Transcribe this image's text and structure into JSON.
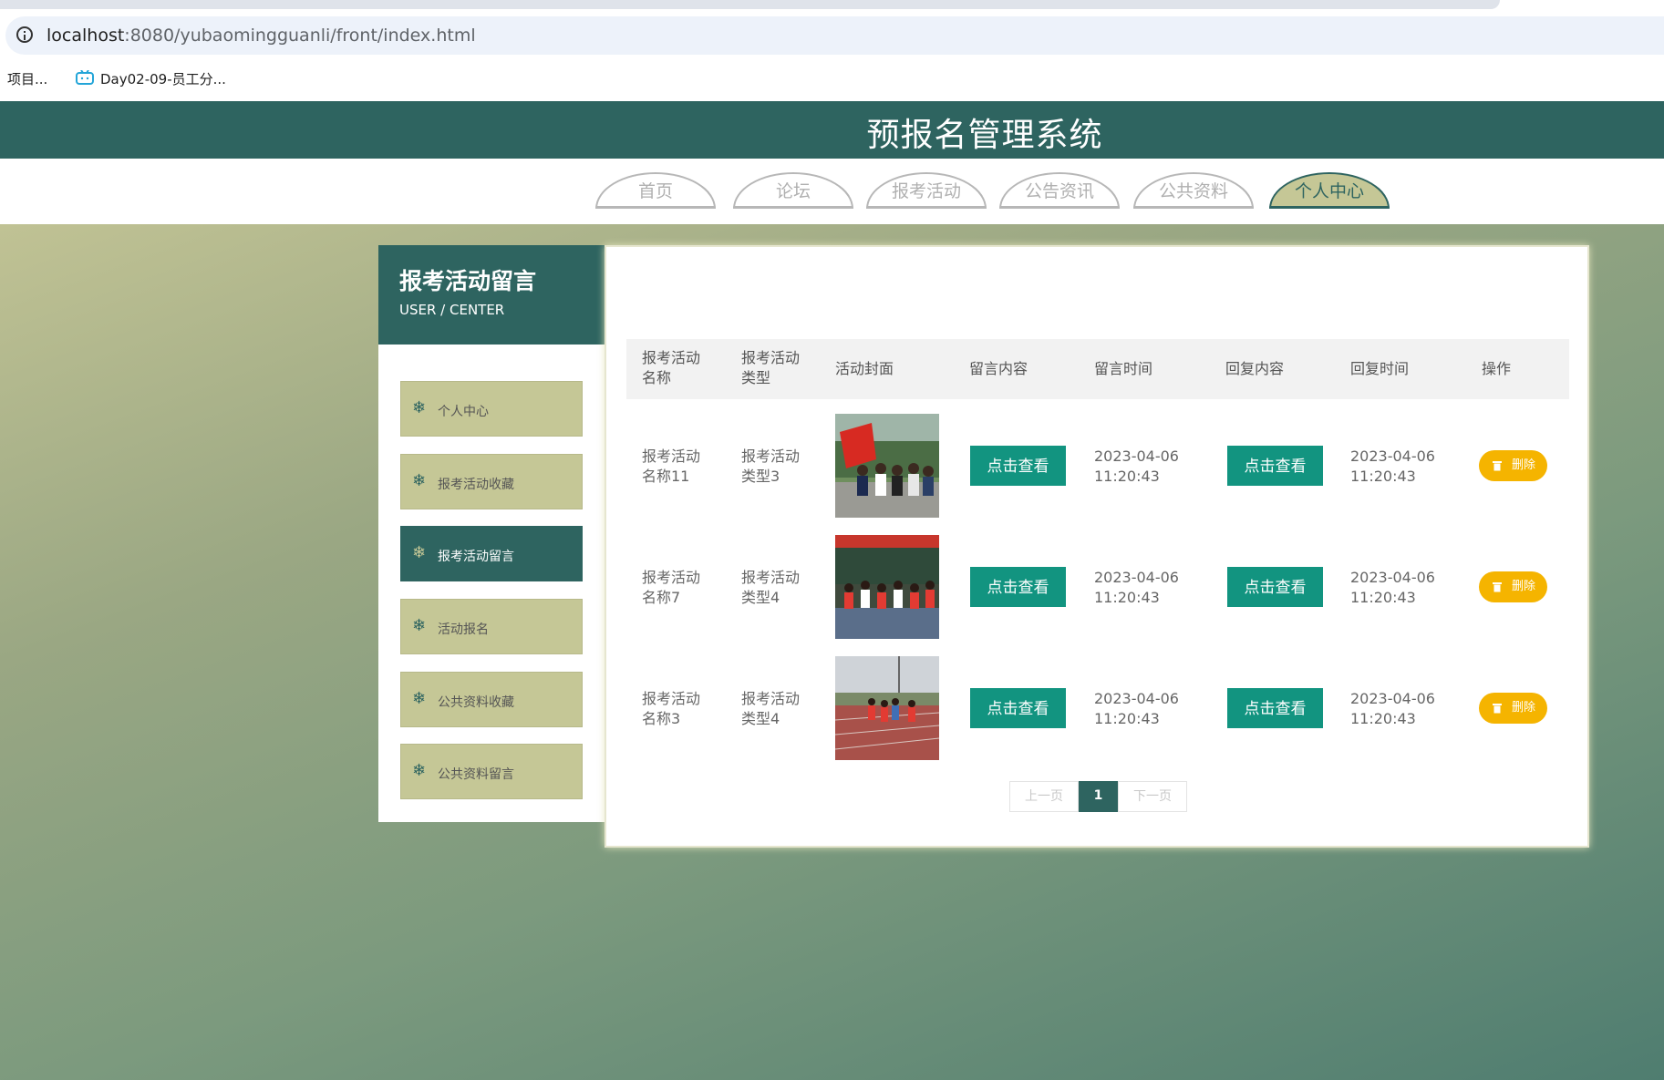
{
  "browser": {
    "url_host": "localhost",
    "url_rest": ":8080/yubaomingguanli/front/index.html",
    "bookmarks": [
      {
        "label": "项目..."
      },
      {
        "label": "Day02-09-员工分..."
      }
    ]
  },
  "site": {
    "title": "预报名管理系统",
    "nav": [
      {
        "label": "首页"
      },
      {
        "label": "论坛"
      },
      {
        "label": "报考活动"
      },
      {
        "label": "公告资讯"
      },
      {
        "label": "公共资料"
      },
      {
        "label": "个人中心",
        "active": true
      }
    ]
  },
  "sidebar": {
    "title": "报考活动留言",
    "subtitle": "USER / CENTER",
    "icon": "snowflake-icon",
    "items": [
      {
        "label": "个人中心"
      },
      {
        "label": "报考活动收藏"
      },
      {
        "label": "报考活动留言",
        "active": true
      },
      {
        "label": "活动报名"
      },
      {
        "label": "公共资料收藏"
      },
      {
        "label": "公共资料留言"
      }
    ]
  },
  "table": {
    "headers": {
      "name": "报考活动\n名称",
      "type": "报考活动\n类型",
      "cover": "活动封面",
      "content": "留言内容",
      "time": "留言时间",
      "reply": "回复内容",
      "reply_time": "回复时间",
      "ops": "操作"
    },
    "view_label": "点击查看",
    "delete_label": "删除",
    "rows": [
      {
        "name": "报考活动\n名称11",
        "type": "报考活动\n类型3",
        "time": "2023-04-06\n11:20:43",
        "reply_time": "2023-04-06\n11:20:43"
      },
      {
        "name": "报考活动\n名称7",
        "type": "报考活动\n类型4",
        "time": "2023-04-06\n11:20:43",
        "reply_time": "2023-04-06\n11:20:43"
      },
      {
        "name": "报考活动\n名称3",
        "type": "报考活动\n类型4",
        "time": "2023-04-06\n11:20:43",
        "reply_time": "2023-04-06\n11:20:43"
      }
    ]
  },
  "pager": {
    "prev": "上一页",
    "current": "1",
    "next": "下一页"
  },
  "colors": {
    "primary": "#2e6460",
    "accent": "#c5c796",
    "button": "#129480",
    "delete": "#f5b400"
  }
}
